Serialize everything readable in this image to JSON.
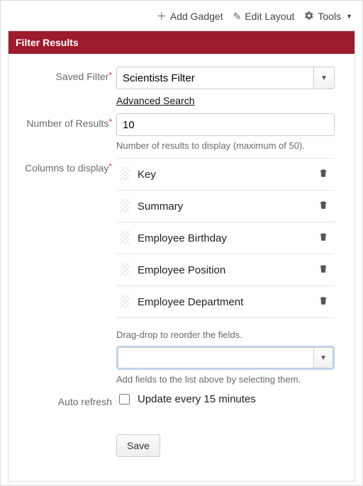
{
  "toolbar": {
    "add_gadget": "Add Gadget",
    "edit_layout": "Edit Layout",
    "tools": "Tools"
  },
  "panel": {
    "title": "Filter Results"
  },
  "form": {
    "saved_filter": {
      "label": "Saved Filter",
      "value": "Scientists Filter",
      "advanced_link": "Advanced Search"
    },
    "num_results": {
      "label": "Number of Results",
      "value": "10",
      "hint": "Number of results to display (maximum of 50)."
    },
    "columns": {
      "label": "Columns to display",
      "items": [
        {
          "name": "Key"
        },
        {
          "name": "Summary"
        },
        {
          "name": "Employee Birthday"
        },
        {
          "name": "Employee Position"
        },
        {
          "name": "Employee Department"
        }
      ],
      "reorder_hint": "Drag-drop to reorder the fields.",
      "add_hint": "Add fields to the list above by selecting them.",
      "add_value": ""
    },
    "auto_refresh": {
      "label": "Auto refresh",
      "checkbox_label": "Update every 15 minutes",
      "checked": false
    },
    "save_label": "Save"
  }
}
